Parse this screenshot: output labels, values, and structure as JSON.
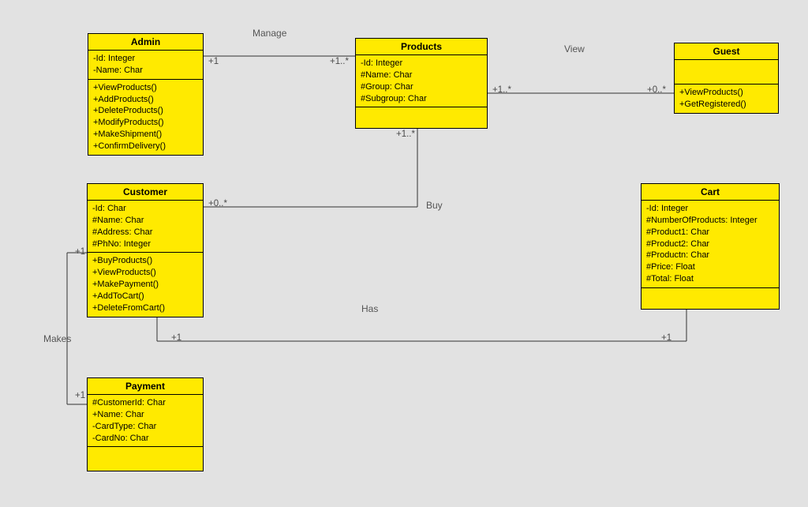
{
  "classes": {
    "admin": {
      "title": "Admin",
      "attributes": [
        "-Id: Integer",
        "-Name: Char"
      ],
      "operations": [
        "+ViewProducts()",
        "+AddProducts()",
        "+DeleteProducts()",
        "+ModifyProducts()",
        "+MakeShipment()",
        "+ConfirmDelivery()"
      ]
    },
    "products": {
      "title": "Products",
      "attributes": [
        "-Id: Integer",
        "#Name: Char",
        "#Group: Char",
        "#Subgroup: Char"
      ],
      "operations": []
    },
    "guest": {
      "title": "Guest",
      "attributes": [],
      "operations": [
        "+ViewProducts()",
        "+GetRegistered()"
      ]
    },
    "customer": {
      "title": "Customer",
      "attributes": [
        "-Id: Char",
        "#Name: Char",
        "#Address: Char",
        "#PhNo: Integer"
      ],
      "operations": [
        "+BuyProducts()",
        "+ViewProducts()",
        "+MakePayment()",
        "+AddToCart()",
        "+DeleteFromCart()"
      ]
    },
    "cart": {
      "title": "Cart",
      "attributes": [
        "-Id: Integer",
        "#NumberOfProducts: Integer",
        "#Product1: Char",
        "#Product2: Char",
        "#Productn: Char",
        "#Price: Float",
        "#Total: Float"
      ],
      "operations": []
    },
    "payment": {
      "title": "Payment",
      "attributes": [
        "#CustomerId: Char",
        "+Name: Char",
        "-CardType: Char",
        "-CardNo: Char"
      ],
      "operations": []
    }
  },
  "relationships": {
    "admin_products": {
      "label": "Manage",
      "m1": "+1",
      "m2": "+1..*"
    },
    "products_guest": {
      "label": "View",
      "m1": "+1..*",
      "m2": "+0..*"
    },
    "customer_products": {
      "label": "Buy",
      "m1": "+0..*",
      "m2": "+1..*"
    },
    "customer_cart": {
      "label": "Has",
      "m1": "+1",
      "m2": "+1"
    },
    "customer_payment": {
      "label": "Makes",
      "m1": "+1",
      "m2": "+1"
    }
  }
}
